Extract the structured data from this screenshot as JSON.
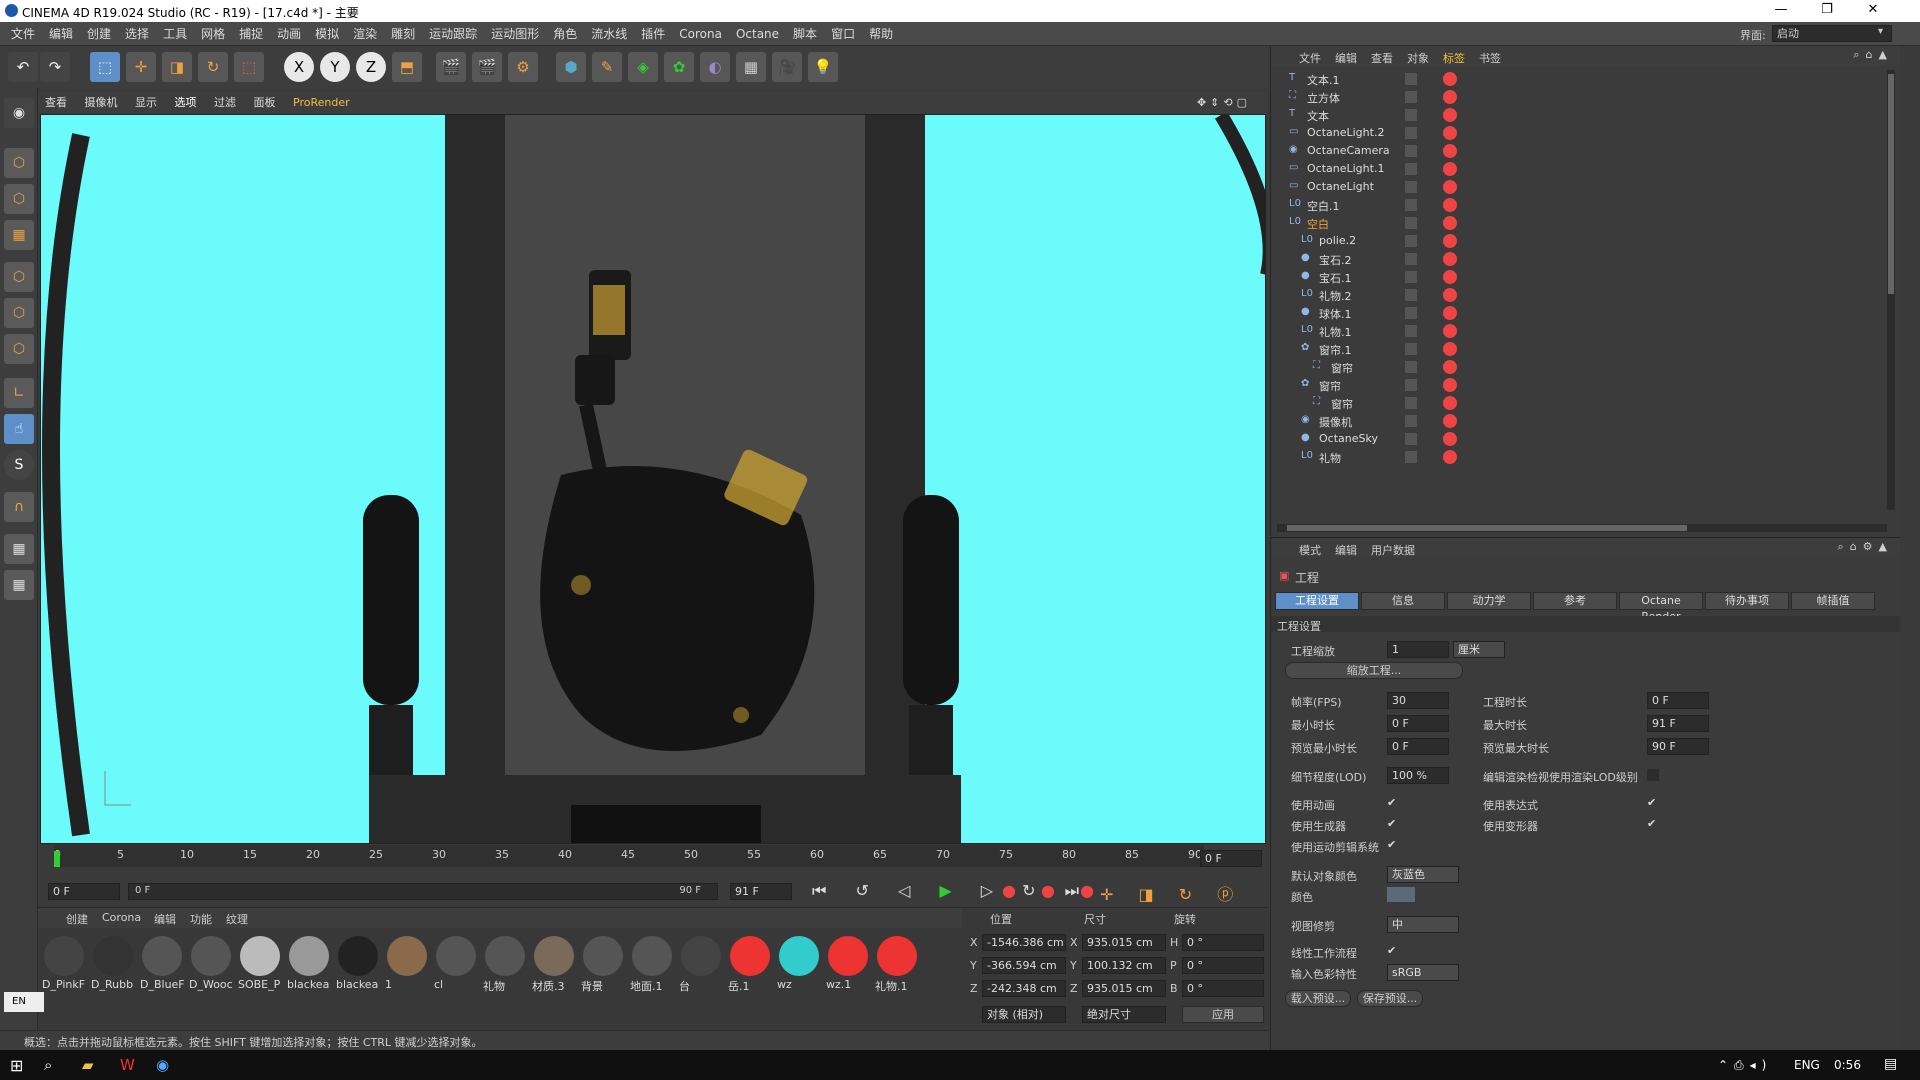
{
  "title": "CINEMA 4D R19.024 Studio (RC - R19) - [17.c4d *] - 主要",
  "window_controls": [
    "—",
    "❐",
    "✕"
  ],
  "menu": [
    "文件",
    "编辑",
    "创建",
    "选择",
    "工具",
    "网格",
    "捕捉",
    "动画",
    "模拟",
    "渲染",
    "雕刻",
    "运动跟踪",
    "运动图形",
    "角色",
    "流水线",
    "插件",
    "Corona",
    "Octane",
    "脚本",
    "窗口",
    "帮助"
  ],
  "interface_label": "界面:",
  "interface_value": "启动",
  "toolbar_labels": [
    "X",
    "Y",
    "Z"
  ],
  "viewport_menu": [
    "查看",
    "摄像机",
    "显示",
    "选项",
    "过滤",
    "面板",
    "ProRender"
  ],
  "timeline_ticks": [
    "0",
    "5",
    "10",
    "15",
    "20",
    "25",
    "30",
    "35",
    "40",
    "45",
    "50",
    "55",
    "60",
    "65",
    "70",
    "75",
    "80",
    "85",
    "90"
  ],
  "timeline_end": "0 F",
  "transport": {
    "start": "0 F",
    "range_start": "0 F",
    "range_end": "90 F",
    "end": "91 F"
  },
  "mat_menu": [
    "创建",
    "Corona",
    "编辑",
    "功能",
    "纹理"
  ],
  "materials_row1": [
    "D_PinkF",
    "D_Rubb",
    "D_BlueF",
    "D_Wooc",
    "SOBE_P",
    "blackea",
    "blackea",
    "1",
    "cl",
    "礼物",
    "材质.3",
    "背景",
    "地面.1",
    "台",
    "岳.1",
    "wz",
    "wz.1",
    "礼物.1"
  ],
  "coords": {
    "headers": [
      "位置",
      "尺寸",
      "旋转"
    ],
    "rows": [
      {
        "axis": "X",
        "pos": "-1546.386 cm",
        "size_axis": "X",
        "size": "935.015 cm",
        "rot_axis": "H",
        "rot": "0 °"
      },
      {
        "axis": "Y",
        "pos": "-366.594 cm",
        "size_axis": "Y",
        "size": "100.132 cm",
        "rot_axis": "P",
        "rot": "0 °"
      },
      {
        "axis": "Z",
        "pos": "-242.348 cm",
        "size_axis": "Z",
        "size": "935.015 cm",
        "rot_axis": "B",
        "rot": "0 °"
      }
    ],
    "mode": "对象 (相对)",
    "size_mode": "绝对尺寸",
    "apply": "应用"
  },
  "status": "概选：点击并拖动鼠标框选元素。按住 SHIFT 键增加选择对象；按住 CTRL 键减少选择对象。",
  "lang_indicator": "EN",
  "obj_menu": [
    "文件",
    "编辑",
    "查看",
    "对象",
    "标签",
    "书签"
  ],
  "objects": [
    {
      "name": "文本.1",
      "icon": "T",
      "indent": 0
    },
    {
      "name": "立方体",
      "icon": "⛶",
      "indent": 0
    },
    {
      "name": "文本",
      "icon": "T",
      "indent": 0
    },
    {
      "name": "OctaneLight.2",
      "icon": "▭",
      "indent": 0
    },
    {
      "name": "OctaneCamera",
      "icon": "◉",
      "indent": 0
    },
    {
      "name": "OctaneLight.1",
      "icon": "▭",
      "indent": 0
    },
    {
      "name": "OctaneLight",
      "icon": "▭",
      "indent": 0
    },
    {
      "name": "空白.1",
      "icon": "L0",
      "indent": 0
    },
    {
      "name": "空白",
      "icon": "L0",
      "indent": 0
    },
    {
      "name": "polie.2",
      "icon": "L0",
      "indent": 1
    },
    {
      "name": "宝石.2",
      "icon": "●",
      "indent": 1
    },
    {
      "name": "宝石.1",
      "icon": "●",
      "indent": 1
    },
    {
      "name": "礼物.2",
      "icon": "L0",
      "indent": 1
    },
    {
      "name": "球体.1",
      "icon": "●",
      "indent": 1
    },
    {
      "name": "礼物.1",
      "icon": "L0",
      "indent": 1
    },
    {
      "name": "窗帘.1",
      "icon": "✿",
      "indent": 1
    },
    {
      "name": "窗帘",
      "icon": "⛶",
      "indent": 2
    },
    {
      "name": "窗帘",
      "icon": "✿",
      "indent": 1
    },
    {
      "name": "窗帘",
      "icon": "⛶",
      "indent": 2
    },
    {
      "name": "摄像机",
      "icon": "◉",
      "indent": 1
    },
    {
      "name": "OctaneSky",
      "icon": "●",
      "indent": 1
    },
    {
      "name": "礼物",
      "icon": "L0",
      "indent": 1
    }
  ],
  "attr_menu": [
    "模式",
    "编辑",
    "用户数据"
  ],
  "attr_title": "工程",
  "attr_tabs": [
    "工程设置",
    "信息",
    "动力学",
    "参考",
    "Octane Render",
    "待办事项",
    "帧插值"
  ],
  "section": "工程设置",
  "fields": {
    "scale_label": "工程缩放",
    "scale": "1",
    "unit": "厘米",
    "scale_btn": "缩放工程...",
    "fps_label": "帧率(FPS)",
    "fps": "30",
    "min_label": "最小时长",
    "min": "0 F",
    "pmin_label": "预览最小时长",
    "pmin": "0 F",
    "dur_label": "工程时长",
    "dur": "0 F",
    "max_label": "最大时长",
    "max": "91 F",
    "pmax_label": "预览最大时长",
    "pmax": "90 F",
    "lod_label": "细节程度(LOD)",
    "lod": "100 %",
    "lod_render": "编辑渲染检视使用渲染LOD级别",
    "anim": "使用动画",
    "expr": "使用表达式",
    "gen": "使用生成器",
    "deform": "使用变形器",
    "mograph": "使用运动剪辑系统",
    "defcolor_label": "默认对象颜色",
    "defcolor": "灰蓝色",
    "color_label": "颜色",
    "clip_label": "视图修剪",
    "clip": "中",
    "linear": "线性工作流程",
    "input_label": "输入色彩特性",
    "input": "sRGB",
    "load": "载入预设...",
    "save": "保存预设..."
  },
  "tray": {
    "lang": "ENG",
    "time": "0:56"
  },
  "colors": {
    "viewport_bg": "#6bfbfb",
    "accent": "#5e8fc9",
    "gold": "#c9a032"
  }
}
